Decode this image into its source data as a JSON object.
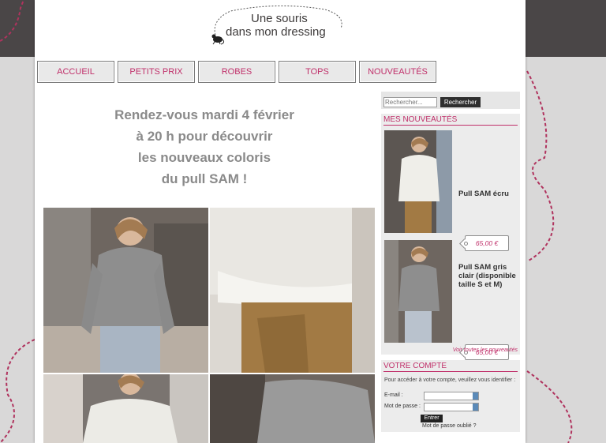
{
  "logo": {
    "line1": "Une souris",
    "line2": "dans mon dressing"
  },
  "nav": [
    {
      "label": "ACCUEIL"
    },
    {
      "label": "PETITS PRIX"
    },
    {
      "label": "ROBES"
    },
    {
      "label": "TOPS"
    },
    {
      "label": "NOUVEAUTÉS"
    }
  ],
  "headline": [
    "Rendez-vous mardi 4 février",
    "à 20 h pour découvrir",
    "les nouveaux coloris",
    "du pull SAM  !"
  ],
  "search": {
    "placeholder": "Rechercher...",
    "button": "Rechercher"
  },
  "new_items": {
    "title": "MES NOUVEAUTÉS",
    "products": [
      {
        "name": "Pull SAM écru",
        "price": "65,00 €"
      },
      {
        "name": "Pull SAM gris clair (disponible taille S et M)",
        "price": "65,00 €"
      }
    ],
    "see_all": "Voir toutes les nouveautés"
  },
  "account": {
    "title": "VOTRE COMPTE",
    "intro": "Pour accéder à votre compte, veuillez vous identifier :",
    "email_label": "E-mail :",
    "password_label": "Mot de passe :",
    "login_button": "Entrer",
    "forgot": "Mot de passe oublié ?"
  },
  "colors": {
    "accent": "#c0306a",
    "header_bg": "#4a4647",
    "body_bg": "#d9d8d8"
  },
  "icons": [
    "mouse-icon",
    "keyboard-icon"
  ]
}
